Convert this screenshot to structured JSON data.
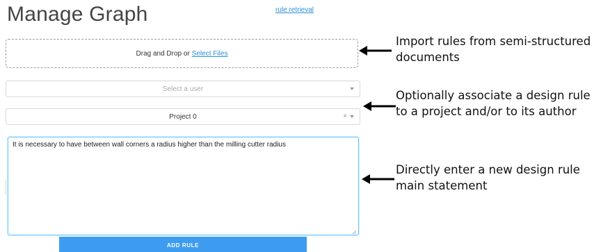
{
  "header": {
    "title": "Manage Graph",
    "top_link": "rule retrieval"
  },
  "import": {
    "prompt": "Drag and Drop or",
    "select_files": "Select Files"
  },
  "user_select": {
    "placeholder": "Select a user"
  },
  "project_select": {
    "value": "Project 0",
    "clear_glyph": "×"
  },
  "rule_input": {
    "value": "It is necessary to have between wall corners a radius higher than the milling cutter radius"
  },
  "add_button": {
    "label": "ADD RULE"
  },
  "annotations": [
    {
      "line1": "Import rules from semi-structured",
      "line2": "documents"
    },
    {
      "line1": "Optionally associate a design rule",
      "line2": "to a project and/or to its author"
    },
    {
      "line1": "Directly enter a new design rule",
      "line2": "main statement"
    }
  ],
  "colors": {
    "accent": "#3d9cf0",
    "link": "#2a8fd6",
    "focus_border": "#66c4ff"
  }
}
